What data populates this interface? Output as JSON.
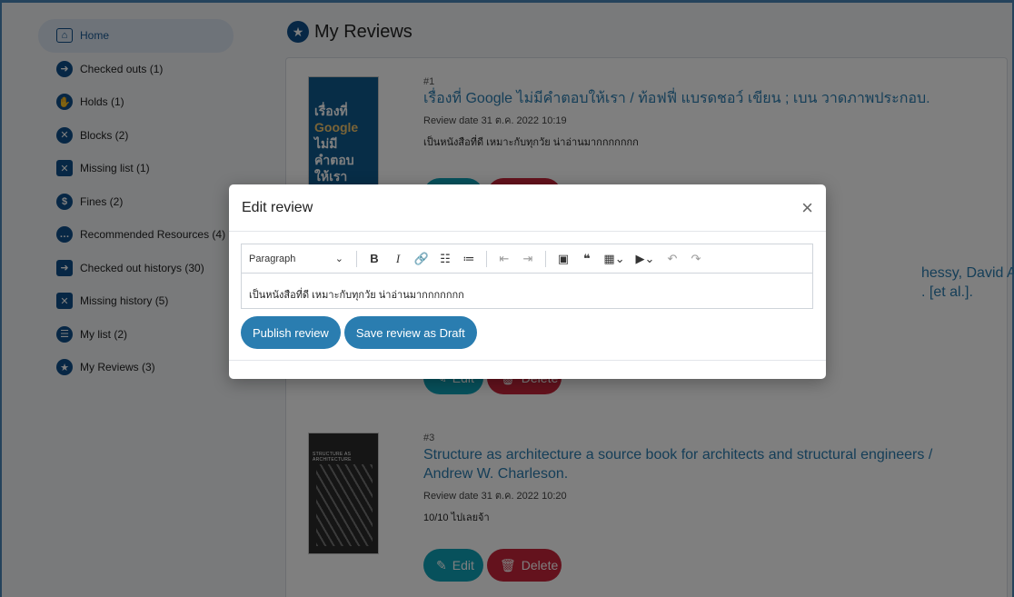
{
  "sidebar": {
    "items": [
      {
        "label": "Home",
        "icon": "home-icon"
      },
      {
        "label": "Checked outs (1)",
        "icon": "arrow-right-icon"
      },
      {
        "label": "Holds (1)",
        "icon": "hand-icon"
      },
      {
        "label": "Blocks (2)",
        "icon": "x-circle-icon"
      },
      {
        "label": "Missing list (1)",
        "icon": "x-square-icon"
      },
      {
        "label": "Fines (2)",
        "icon": "dollar-icon"
      },
      {
        "label": "Recommended Resources (4)",
        "icon": "chat-icon"
      },
      {
        "label": "Checked out historys (30)",
        "icon": "arrow-square-icon"
      },
      {
        "label": "Missing history (5)",
        "icon": "x-square-icon"
      },
      {
        "label": "My list (2)",
        "icon": "list-icon"
      },
      {
        "label": "My Reviews (3)",
        "icon": "star-icon"
      }
    ]
  },
  "page": {
    "title": "My Reviews"
  },
  "reviews": [
    {
      "num": "#1",
      "title": "เรื่องที่ Google ไม่มีคำตอบให้เรา / ท้อฟฟี่ แบรดชอว์ เขียน ; เบน วาดภาพประกอบ.",
      "date": "Review date 31 ต.ค. 2022 10:19",
      "text": "เป็นหนังสือที่ดี เหมาะกับทุกวัย น่าอ่านมากกกกกกก"
    },
    {
      "title_tail_1": "hessy, David A.",
      "title_tail_2": ". [et al.]."
    },
    {
      "num": "#3",
      "title": "Structure as architecture a source book for architects and structural engineers / Andrew W. Charleson.",
      "date": "Review date 31 ต.ค. 2022 10:20",
      "text": "10/10 ไปเลยจ้า",
      "cover_label": "STRUCTURE AS ARCHITECTURE"
    }
  ],
  "cover1": {
    "line1": "เรื่องที่",
    "line2": "Google",
    "line3": "ไม่มี",
    "line4": "คำตอบ",
    "line5": "ให้เรา"
  },
  "buttons": {
    "edit": "Edit",
    "delete": "Delete"
  },
  "modal": {
    "title": "Edit review",
    "format_select": "Paragraph",
    "content": "เป็นหนังสือที่ดี เหมาะกับทุกวัย น่าอ่านมากกกกกกก",
    "publish": "Publish review",
    "draft": "Save review as Draft"
  },
  "colors": {
    "accent": "#2a7db0",
    "edit": "#0fa3b8",
    "delete": "#c8253a",
    "brand": "#0e4f8b"
  }
}
